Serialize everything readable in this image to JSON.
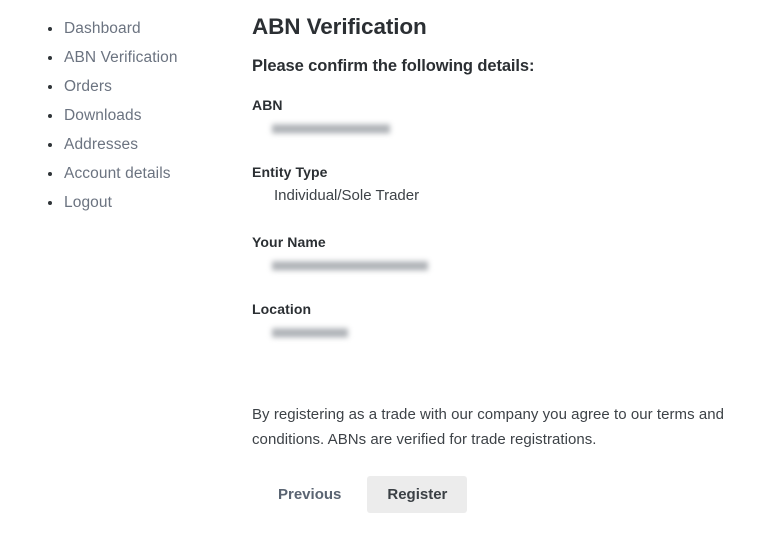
{
  "sidebar": {
    "items": [
      {
        "label": "Dashboard"
      },
      {
        "label": "ABN Verification"
      },
      {
        "label": "Orders"
      },
      {
        "label": "Downloads"
      },
      {
        "label": "Addresses"
      },
      {
        "label": "Account details"
      },
      {
        "label": "Logout"
      }
    ]
  },
  "main": {
    "title": "ABN Verification",
    "subtitle": "Please confirm the following details:",
    "fields": [
      {
        "label": "ABN",
        "value": "",
        "redacted": true
      },
      {
        "label": "Entity Type",
        "value": "Individual/Sole Trader",
        "redacted": false
      },
      {
        "label": "Your Name",
        "value": "",
        "redacted": true
      },
      {
        "label": "Location",
        "value": "",
        "redacted": true
      }
    ],
    "terms": "By registering as a trade with our company you agree to our terms and conditions. ABNs are verified for trade registrations.",
    "actions": {
      "previous_label": "Previous",
      "register_label": "Register"
    }
  },
  "colors": {
    "heading": "#2b2f33",
    "body_text": "#3d4247",
    "nav_link": "#6b7380",
    "button_link": "#5a6472",
    "button_bg": "#ececec",
    "background": "#ffffff"
  }
}
